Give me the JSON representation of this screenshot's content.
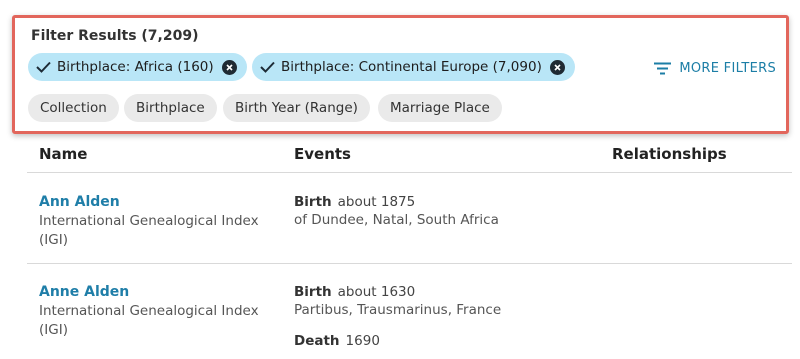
{
  "filters": {
    "title": "Filter Results (7,209)",
    "active": [
      {
        "label": "Birthplace: Africa (160)"
      },
      {
        "label": "Birthplace: Continental Europe (7,090)"
      }
    ],
    "more_filters_label": "MORE FILTERS",
    "quick": [
      "Collection",
      "Birthplace",
      "Birth Year (Range)",
      "Marriage Place"
    ]
  },
  "table": {
    "headers": {
      "name": "Name",
      "events": "Events",
      "relationships": "Relationships"
    },
    "rows": [
      {
        "name": "Ann Alden",
        "collection": "International Genealogical Index (IGI)",
        "events": [
          {
            "type": "Birth",
            "date": "about 1875",
            "place": "of Dundee, Natal, South Africa"
          }
        ]
      },
      {
        "name": "Anne Alden",
        "collection": "International Genealogical Index (IGI)",
        "events": [
          {
            "type": "Birth",
            "date": "about 1630",
            "place": "Partibus, Trausmarinus, France"
          },
          {
            "type": "Death",
            "date": "1690",
            "place": ""
          }
        ]
      }
    ]
  },
  "colors": {
    "highlight_border": "#e2665c",
    "active_chip": "#b9e6f7",
    "link": "#1f7ea8",
    "inactive_chip": "#eaeaea"
  },
  "icons": {
    "check": "check-icon",
    "remove": "close-circle-icon",
    "filter": "filter-lines-icon"
  }
}
